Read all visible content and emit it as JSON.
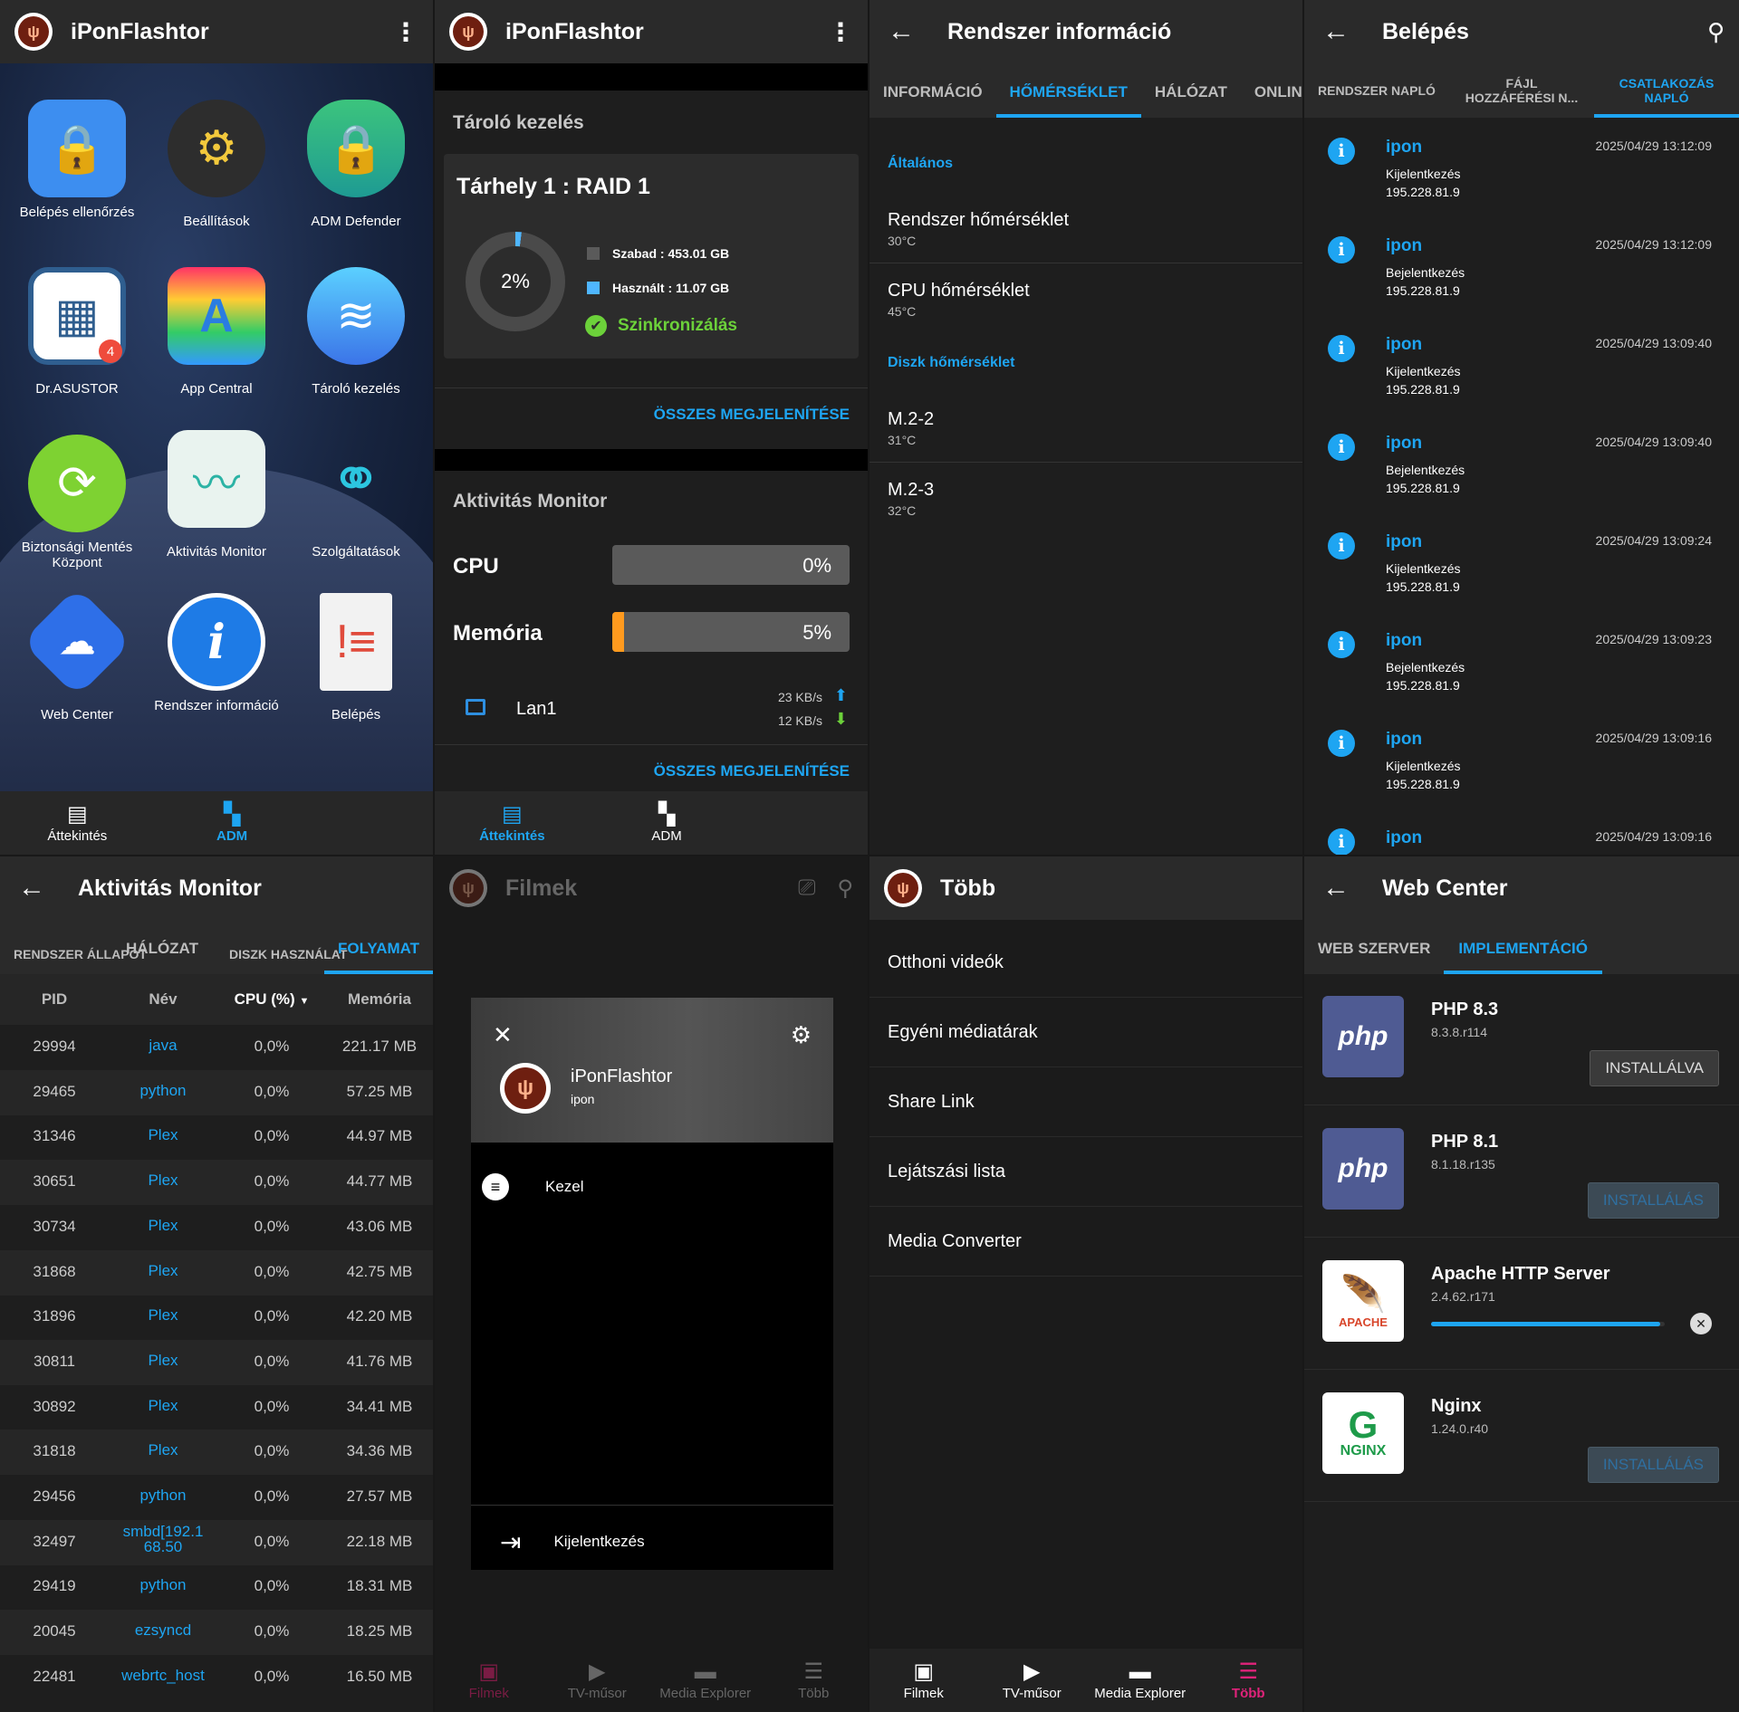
{
  "p1": {
    "title": "iPonFlashtor",
    "apps": [
      {
        "label": "Belépés ellenőrzés",
        "icon": "login-check-icon"
      },
      {
        "label": "Beállítások",
        "icon": "gear-icon"
      },
      {
        "label": "ADM Defender",
        "icon": "shield-lock-icon"
      },
      {
        "label": "Dr.ASUSTOR",
        "icon": "doctor-nas-icon",
        "badge": "4"
      },
      {
        "label": "App Central",
        "icon": "app-central-icon"
      },
      {
        "label": "Tároló kezelés",
        "icon": "storage-icon"
      },
      {
        "label": "Biztonsági Mentés Központ",
        "icon": "backup-icon"
      },
      {
        "label": "Aktivitás Monitor",
        "icon": "activity-monitor-icon"
      },
      {
        "label": "Szolgáltatások",
        "icon": "services-icon"
      },
      {
        "label": "Web Center",
        "icon": "web-center-icon"
      },
      {
        "label": "Rendszer információ",
        "icon": "info-icon"
      },
      {
        "label": "Belépés",
        "icon": "log-icon"
      }
    ],
    "nav": [
      {
        "label": "Áttekintés"
      },
      {
        "label": "ADM"
      }
    ]
  },
  "p2": {
    "title": "iPonFlashtor",
    "storage_title": "Tároló kezelés",
    "volume": "Tárhely 1 : RAID 1",
    "usage": "2%",
    "usage_fraction": 0.02,
    "free": "Szabad : 453.01 GB",
    "used": "Használt : 11.07 GB",
    "sync": "Szinkronizálás",
    "show_all": "ÖSSZES MEGJELENÍTÉSE",
    "monitor_title": "Aktivitás Monitor",
    "cpu_label": "CPU",
    "cpu_value": "0%",
    "cpu_fraction": 0,
    "mem_label": "Memória",
    "mem_value": "5%",
    "mem_fraction": 0.05,
    "lan": "Lan1",
    "up": "23 KB/s",
    "down": "12 KB/s",
    "show_all2": "ÖSSZES MEGJELENÍTÉSE",
    "nav": [
      {
        "label": "Áttekintés"
      },
      {
        "label": "ADM"
      }
    ],
    "colors": {
      "used": "#4fb6ff",
      "free": "#4a4a4a",
      "accent": "#1ea5f2"
    }
  },
  "p3": {
    "title": "Rendszer információ",
    "tabs": [
      "INFORMÁCIÓ",
      "HŐMÉRSÉKLET",
      "HÁLÓZAT",
      "ONLINE F"
    ],
    "general": "Általános",
    "rows1": [
      {
        "t": "Rendszer hőmérséklet",
        "v": "30°C"
      },
      {
        "t": "CPU hőmérséklet",
        "v": "45°C"
      }
    ],
    "disk": "Diszk hőmérséklet",
    "rows2": [
      {
        "t": "M.2-2",
        "v": "31°C"
      },
      {
        "t": "M.2-3",
        "v": "32°C"
      }
    ]
  },
  "p4": {
    "title": "Belépés",
    "tabs": [
      "RENDSZER NAPLÓ",
      "FÁJL HOZZÁFÉRÉSI N...",
      "CSATLAKOZÁS NAPLÓ"
    ],
    "logs": [
      {
        "user": "ipon",
        "ts": "2025/04/29 13:12:09",
        "ev": "Kijelentkezés",
        "ip": "195.228.81.9"
      },
      {
        "user": "ipon",
        "ts": "2025/04/29 13:12:09",
        "ev": "Bejelentkezés",
        "ip": "195.228.81.9"
      },
      {
        "user": "ipon",
        "ts": "2025/04/29 13:09:40",
        "ev": "Kijelentkezés",
        "ip": "195.228.81.9"
      },
      {
        "user": "ipon",
        "ts": "2025/04/29 13:09:40",
        "ev": "Bejelentkezés",
        "ip": "195.228.81.9"
      },
      {
        "user": "ipon",
        "ts": "2025/04/29 13:09:24",
        "ev": "Kijelentkezés",
        "ip": "195.228.81.9"
      },
      {
        "user": "ipon",
        "ts": "2025/04/29 13:09:23",
        "ev": "Bejelentkezés",
        "ip": "195.228.81.9"
      },
      {
        "user": "ipon",
        "ts": "2025/04/29 13:09:16",
        "ev": "Kijelentkezés",
        "ip": "195.228.81.9"
      },
      {
        "user": "ipon",
        "ts": "2025/04/29 13:09:16",
        "ev": "",
        "ip": ""
      }
    ]
  },
  "p5": {
    "title": "Aktivitás Monitor",
    "tabs": [
      "RENDSZER ÁLLAPOT",
      "HÁLÓZAT",
      "DISZK HASZNÁLAT",
      "FOLYAMAT"
    ],
    "headers": [
      "PID",
      "Név",
      "CPU (%)",
      "Memória"
    ],
    "rows": [
      [
        "29994",
        "java",
        "0,0%",
        "221.17 MB"
      ],
      [
        "29465",
        "python",
        "0,0%",
        "57.25 MB"
      ],
      [
        "31346",
        "Plex",
        "0,0%",
        "44.97 MB"
      ],
      [
        "30651",
        "Plex",
        "0,0%",
        "44.77 MB"
      ],
      [
        "30734",
        "Plex",
        "0,0%",
        "43.06 MB"
      ],
      [
        "31868",
        "Plex",
        "0,0%",
        "42.75 MB"
      ],
      [
        "31896",
        "Plex",
        "0,0%",
        "42.20 MB"
      ],
      [
        "30811",
        "Plex",
        "0,0%",
        "41.76 MB"
      ],
      [
        "30892",
        "Plex",
        "0,0%",
        "34.41 MB"
      ],
      [
        "31818",
        "Plex",
        "0,0%",
        "34.36 MB"
      ],
      [
        "29456",
        "python",
        "0,0%",
        "27.57 MB"
      ],
      [
        "32497",
        "smbd[192.168.50",
        "0,0%",
        "22.18 MB"
      ],
      [
        "29419",
        "python",
        "0,0%",
        "18.31 MB"
      ],
      [
        "20045",
        "ezsyncd",
        "0,0%",
        "18.25 MB"
      ],
      [
        "22481",
        "webrtc_host",
        "0,0%",
        "16.50 MB"
      ]
    ]
  },
  "p6": {
    "title": "Filmek",
    "app": "iPonFlashtor",
    "user": "ipon",
    "manage": "Kezel",
    "logout": "Kijelentkezés",
    "nav": [
      {
        "label": "Filmek"
      },
      {
        "label": "TV-műsor"
      },
      {
        "label": "Media Explorer"
      },
      {
        "label": "Több"
      }
    ]
  },
  "p7": {
    "title": "Több",
    "items": [
      "Otthoni videók",
      "Egyéni médiatárak",
      "Share Link",
      "Lejátszási lista",
      "Media Converter"
    ],
    "nav": [
      {
        "label": "Filmek"
      },
      {
        "label": "TV-műsor"
      },
      {
        "label": "Media Explorer"
      },
      {
        "label": "Több"
      }
    ]
  },
  "p8": {
    "title": "Web Center",
    "tabs": [
      "WEB SZERVER",
      "IMPLEMENTÁCIÓ"
    ],
    "items": [
      {
        "name": "PHP 8.3",
        "ver": "8.3.8.r114",
        "btn": "INSTALLÁLVA",
        "logo": "php"
      },
      {
        "name": "PHP 8.1",
        "ver": "8.1.18.r135",
        "btn": "INSTALLÁLÁS",
        "logo": "php"
      },
      {
        "name": "Apache HTTP Server",
        "ver": "2.4.62.r171",
        "btn": "",
        "logo": "APACHE",
        "progress": 0.98
      },
      {
        "name": "Nginx",
        "ver": "1.24.0.r40",
        "btn": "INSTALLÁLÁS",
        "logo": "NGINX"
      }
    ]
  }
}
